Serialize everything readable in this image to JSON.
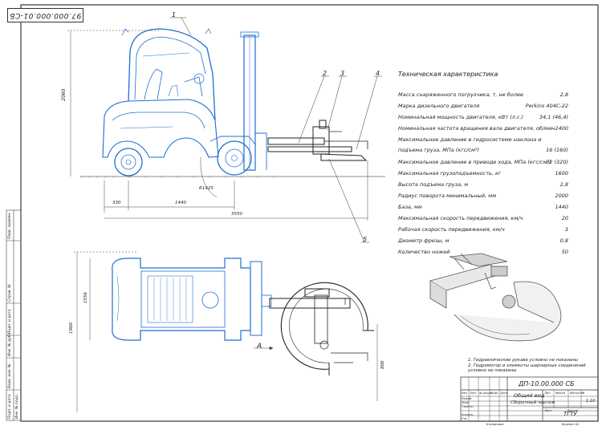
{
  "stamp": {
    "code": "97.000.000.01-СБ"
  },
  "spec": {
    "title": "Техническая характеристика",
    "rows": [
      {
        "label": "Масса снаряженного погрузчика, т, не более",
        "value": "2,8"
      },
      {
        "label": "Марка дизельного двигателя",
        "value": "Perkins 404C-22"
      },
      {
        "label": "Номинальная мощность двигателя, кВт (л.с.)",
        "value": "34,1 (46,4)"
      },
      {
        "label": "Номинальная частота вращения вала двигателя, об/мин",
        "value": "2400"
      },
      {
        "label": "Максимальное давление в гидросистеме наклона и",
        "value": ""
      },
      {
        "label": "подъема груза, МПа (кгс/см²)",
        "value": "16 (160)"
      },
      {
        "label": "Максимальное давление в приводе хода, МПа (кгс/см²)",
        "value": "32 (320)"
      },
      {
        "label": "Максимальная грузоподъемность, кг",
        "value": "1600"
      },
      {
        "label": "Высота подъема груза, м",
        "value": "2,8"
      },
      {
        "label": "Радиус поворота минимальный, мм",
        "value": "2000"
      },
      {
        "label": "База, мм",
        "value": "1440"
      },
      {
        "label": "Максимальная скорость передвижения, км/ч",
        "value": "20"
      },
      {
        "label": "Рабочая скорость передвижения, км/ч",
        "value": "3"
      },
      {
        "label": "Диаметр фрезы, м",
        "value": "0,8"
      },
      {
        "label": "Количество ножей",
        "value": "50"
      }
    ]
  },
  "notes": [
    "1. Гидравлические рукава условно не показаны",
    "2. Гидромотор и элементы шарнирных соединений условно не показаны"
  ],
  "dims": {
    "h2060": "2060",
    "r1425": "R1425",
    "d330": "330",
    "d1440": "1440",
    "d3550": "3550",
    "d1556": "1556",
    "d1900": "1900",
    "d800": "800"
  },
  "callouts": [
    "1",
    "2",
    "3",
    "4",
    "5"
  ],
  "view_marker": "A",
  "title_block": {
    "doc_code": "ДП-10.00.000 СБ",
    "name_line1": "Общий вид",
    "name_line2": "Сборочный чертеж",
    "org": "ТГТУ",
    "scale": "1:10",
    "mass": "",
    "sheet": "Лист",
    "sheets": "Листов",
    "copied": "Копировал",
    "format": "Формат  А1",
    "roles": [
      "Изм",
      "Лист",
      "№ докум.",
      "Подп.",
      "Дата"
    ],
    "people_roles": [
      "Разраб.",
      "Пров.",
      "Т.контр.",
      "",
      "Н.контр.",
      "Утв."
    ],
    "col_labels": [
      "Лит.",
      "Масса",
      "Масштаб"
    ]
  },
  "side_strip": [
    "Перв. примен.",
    "Справ. №",
    "Подп. и дата",
    "Инв. № дубл.",
    "Взам. инв. №",
    "Подп. и дата",
    "Инв. № подл."
  ]
}
